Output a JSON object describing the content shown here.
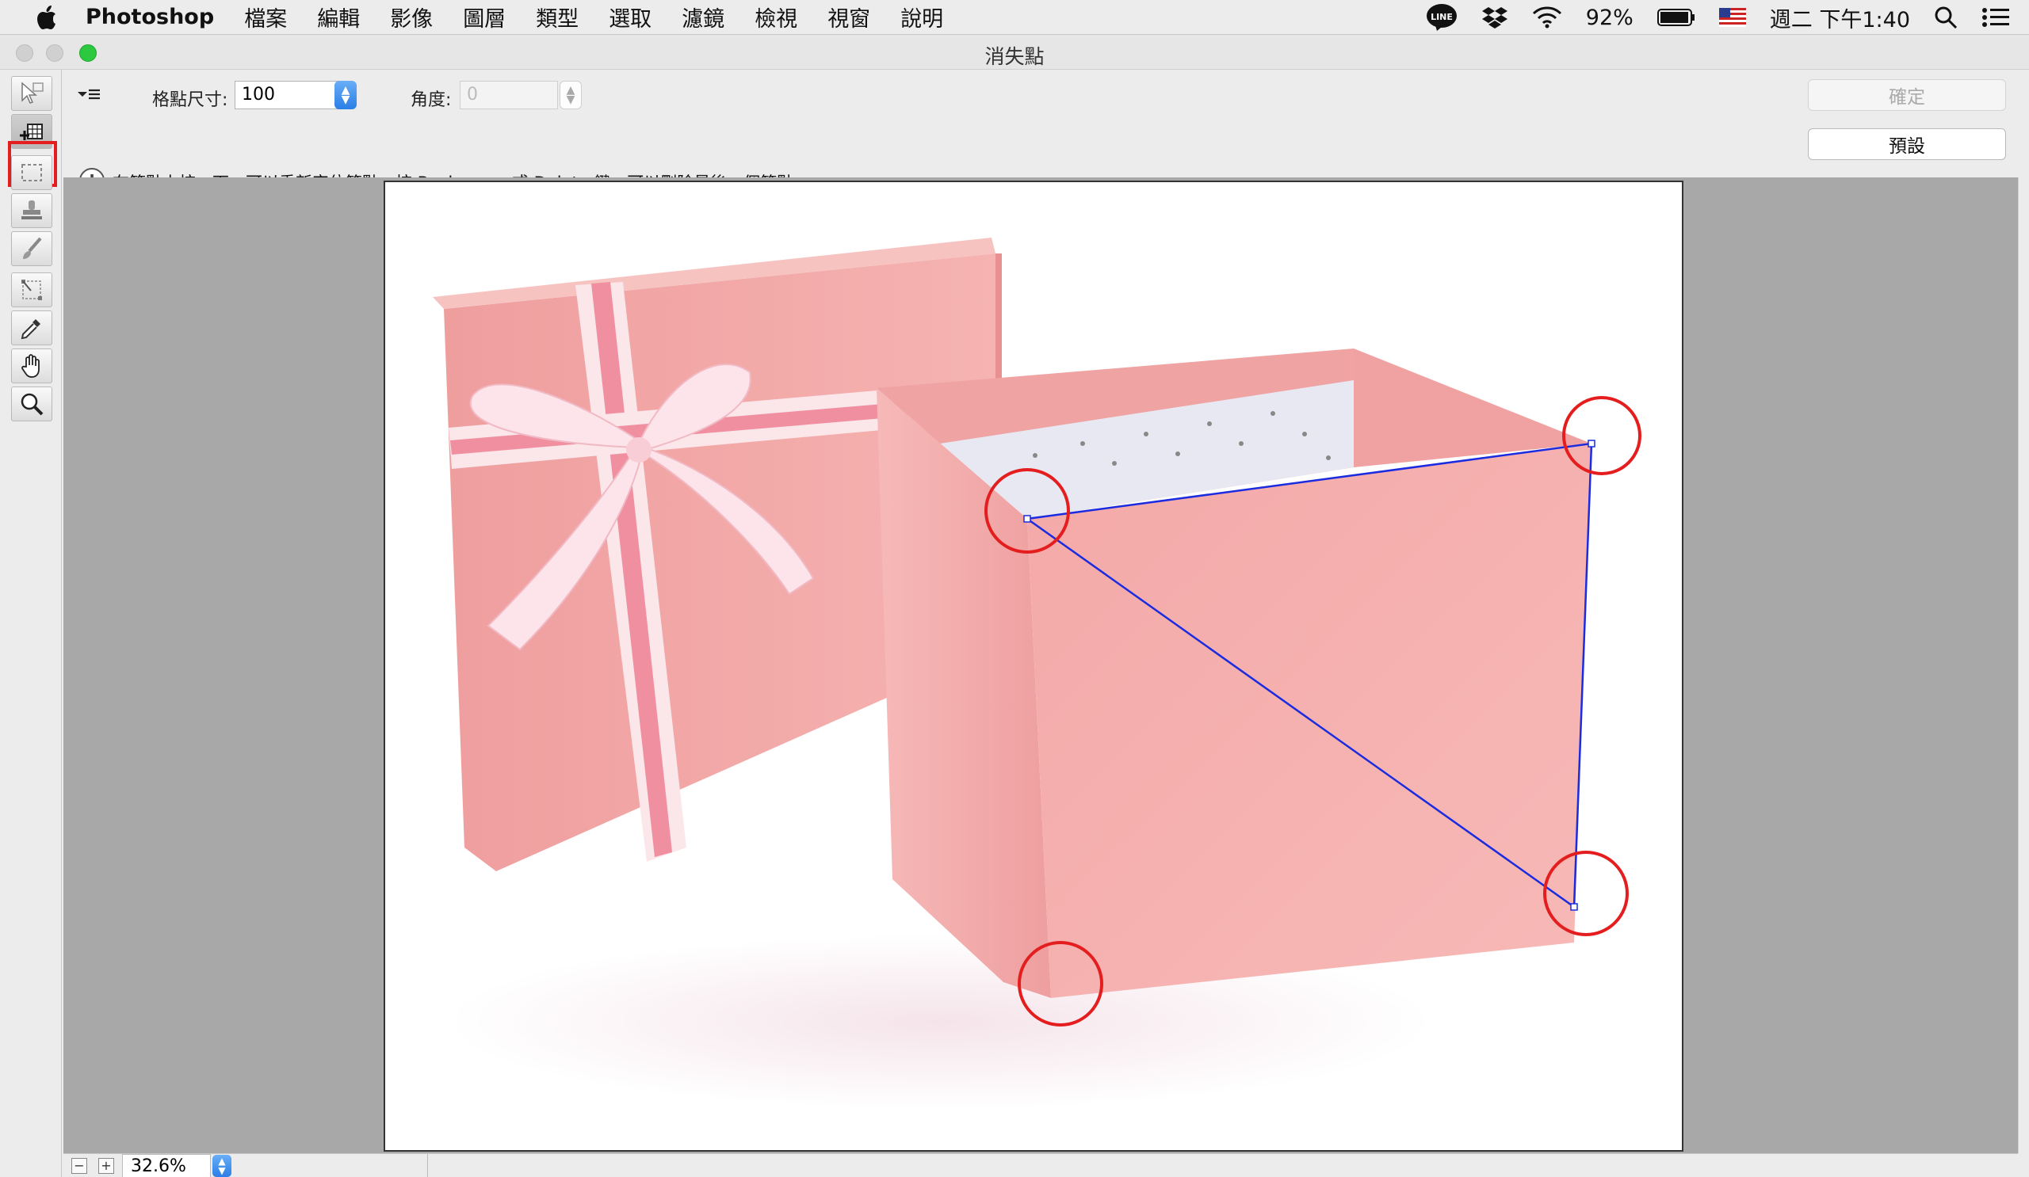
{
  "menubar": {
    "app": "Photoshop",
    "items": [
      "檔案",
      "編輯",
      "影像",
      "圖層",
      "類型",
      "選取",
      "濾鏡",
      "檢視",
      "視窗",
      "說明"
    ],
    "battery": "92%",
    "clock": "週二 下午1:40",
    "line_badge": "LINE"
  },
  "window": {
    "title": "消失點"
  },
  "toolbar": {
    "grid_label": "格點尺寸:",
    "grid_value": "100",
    "angle_label": "角度:",
    "angle_value": "0",
    "ok_label": "確定",
    "default_label": "預設"
  },
  "info": {
    "icon": "!",
    "text": "在節點上按一下，可以重新定位節點。按 Backspace 或 Delete 鍵，可以刪除最後一個節點。"
  },
  "tools": [
    "edit-plane-tool",
    "create-plane-tool",
    "marquee-tool",
    "stamp-tool",
    "brush-tool",
    "transform-tool",
    "eyedropper-tool",
    "hand-tool",
    "zoom-tool"
  ],
  "status": {
    "zoom": "32.6%",
    "zoom_out": "−",
    "zoom_in": "+"
  },
  "colors": {
    "highlight": "#e41e1e",
    "plane": "#1a2be0",
    "box": "#f2aaa8"
  }
}
